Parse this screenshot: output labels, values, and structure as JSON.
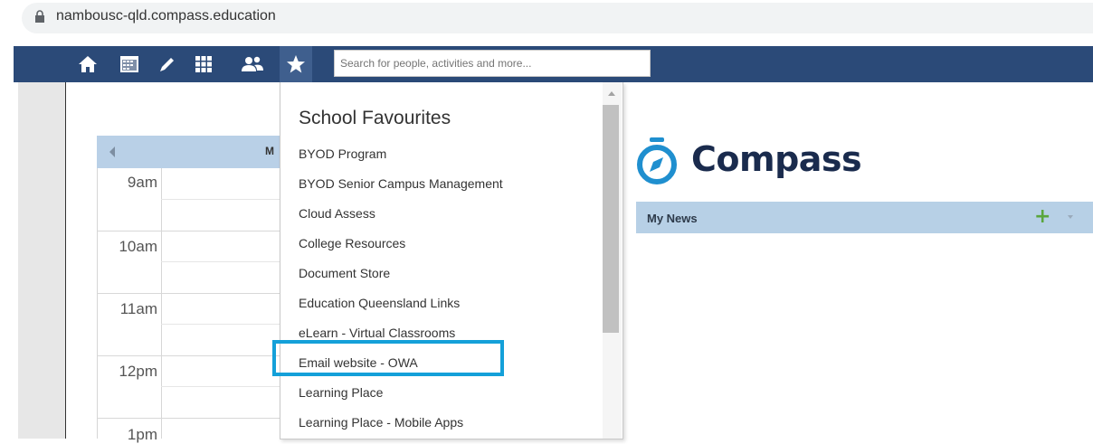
{
  "browser": {
    "url": "nambousc-qld.compass.education"
  },
  "toolbar": {
    "icons": [
      "home-icon",
      "calendar-icon",
      "pencil-icon",
      "grid-icon",
      "people-icon",
      "star-icon"
    ],
    "search_placeholder": "Search for people, activities and more...",
    "color": "#2b4a78"
  },
  "calendar": {
    "day_label": "M",
    "hours": [
      "9am",
      "10am",
      "11am",
      "12pm",
      "1pm"
    ]
  },
  "favourites": {
    "title": "School Favourites",
    "items": [
      "BYOD Program",
      "BYOD Senior Campus Management",
      "Cloud Assess",
      "College Resources",
      "Document Store",
      "Education Queensland Links",
      "eLearn - Virtual Classrooms",
      "Email website - OWA",
      "Learning Place",
      "Learning Place - Mobile Apps"
    ],
    "highlighted": "Email website - OWA",
    "highlight_color": "#14a0d9"
  },
  "brand": {
    "name": "Compass",
    "color": "#1a2b4d",
    "icon_color": "#1f8fcf"
  },
  "news": {
    "label": "My News",
    "add_symbol": "+"
  }
}
